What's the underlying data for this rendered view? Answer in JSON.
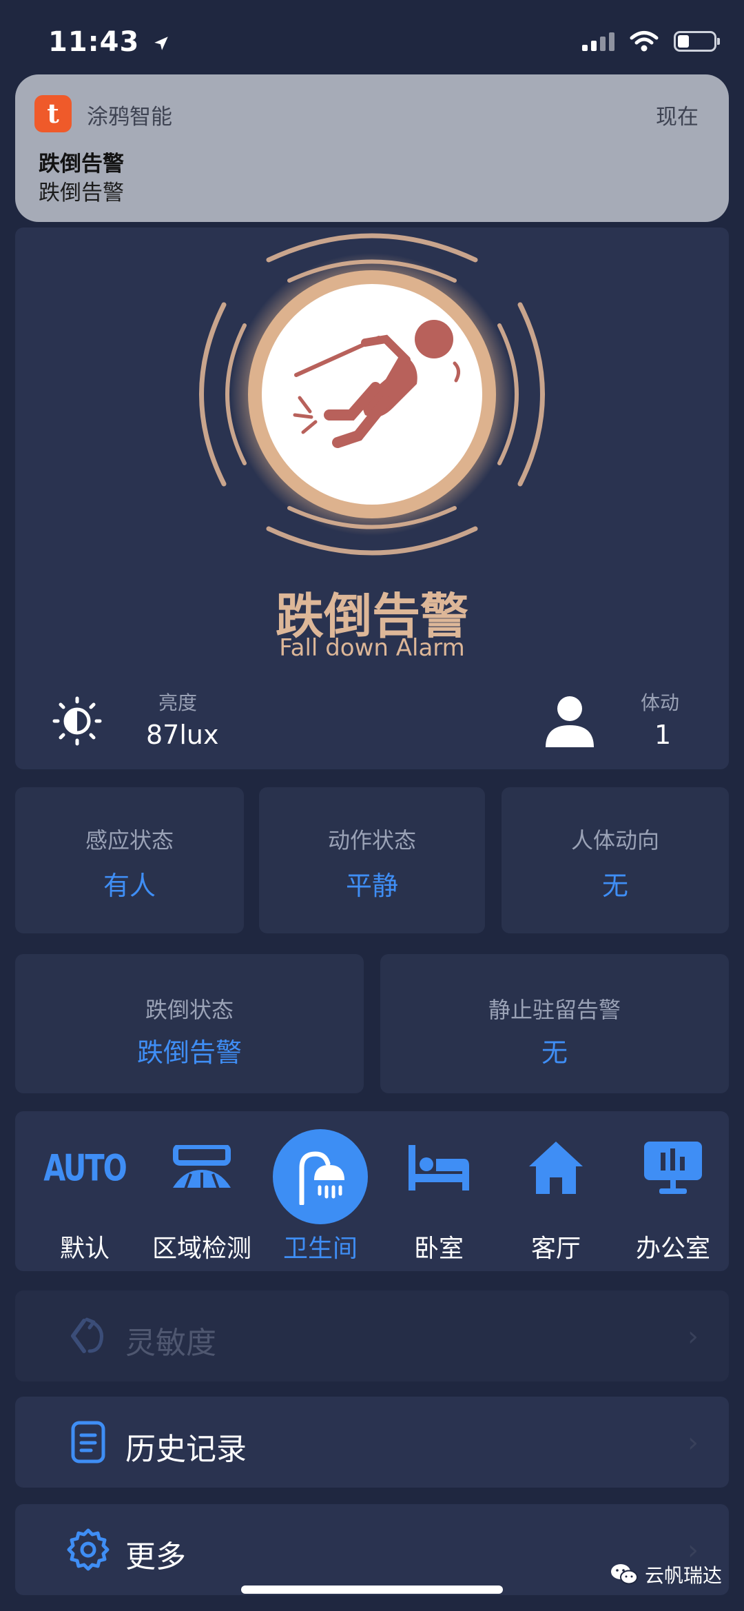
{
  "status_bar": {
    "time": "11:43",
    "icons": [
      "location-arrow-icon",
      "signal-icon",
      "wifi-icon",
      "battery-icon"
    ]
  },
  "notification": {
    "app_name": "涂鸦智能",
    "time": "现在",
    "title": "跌倒告警",
    "body": "跌倒告警",
    "app_icon_letter": "t"
  },
  "alarm": {
    "title": "跌倒告警",
    "subtitle": "Fall down Alarm"
  },
  "sensors": {
    "brightness": {
      "label": "亮度",
      "value": "87lux",
      "icon": "brightness-icon"
    },
    "motion": {
      "label": "体动",
      "value": "1",
      "icon": "person-icon"
    }
  },
  "status_tiles": [
    {
      "label": "感应状态",
      "value": "有人"
    },
    {
      "label": "动作状态",
      "value": "平静"
    },
    {
      "label": "人体动向",
      "value": "无"
    }
  ],
  "status_tiles_2": [
    {
      "label": "跌倒状态",
      "value": "跌倒告警"
    },
    {
      "label": "静止驻留告警",
      "value": "无"
    }
  ],
  "modes": {
    "auto_glyph": "AUTO",
    "items": [
      {
        "label": "默认",
        "icon": "auto-icon"
      },
      {
        "label": "区域检测",
        "icon": "radar-icon"
      },
      {
        "label": "卫生间",
        "icon": "shower-icon",
        "active": true
      },
      {
        "label": "卧室",
        "icon": "bed-icon"
      },
      {
        "label": "客厅",
        "icon": "house-icon"
      },
      {
        "label": "办公室",
        "icon": "monitor-icon"
      }
    ]
  },
  "menu": {
    "sensitivity": "灵敏度",
    "history": "历史记录",
    "more": "更多",
    "chevron": "›"
  },
  "watermark": "云帆瑞达",
  "colors": {
    "background": "#1f2740",
    "card": "#2a3350",
    "accent": "#3f8ef5",
    "alarm": "#ddb798",
    "banner": "#a6abb7",
    "app_icon": "#ef5a2a"
  }
}
